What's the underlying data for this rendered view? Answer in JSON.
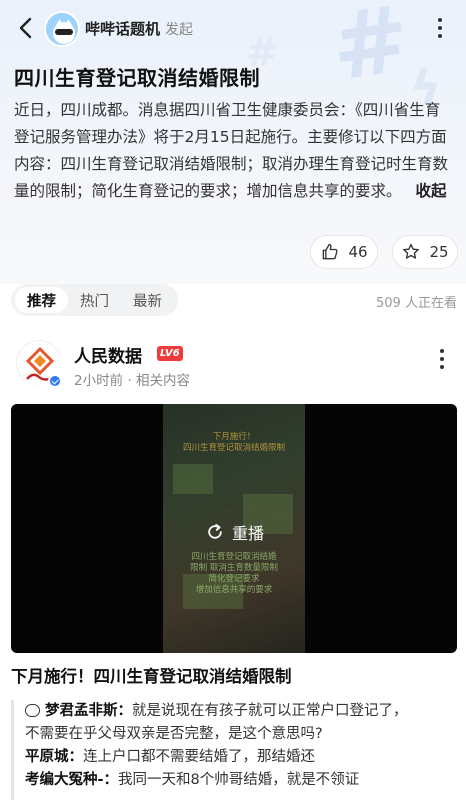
{
  "header": {
    "topic_name": "哔哔话题机",
    "topic_sub": "发起"
  },
  "topic": {
    "title": "四川生育登记取消结婚限制",
    "description": "近日，四川成都。消息据四川省卫生健康委员会：《四川省生育登记服务管理办法》将于2月15日起施行。主要修订以下四方面内容：四川生育登记取消结婚限制；取消办理生育登记时生育数量的限制；简化生育登记的要求；增加信息共享的要求。",
    "collapse_label": "收起",
    "like_count": "46",
    "share_count": "25"
  },
  "tabs": [
    {
      "label": "推荐",
      "active": true
    },
    {
      "label": "热门",
      "active": false
    },
    {
      "label": "最新",
      "active": false
    }
  ],
  "watching": "509 人正在看",
  "post": {
    "author": "人民数据",
    "level": "LV6",
    "meta": "2小时前 · 相关内容",
    "video_caption_lines": [
      "下月施行！",
      "四川生育登记取消结婚限制"
    ],
    "video_body_lines": [
      "四川生育登记取消结婚",
      "限制 取消生育数量限制",
      "简化登记要求",
      "增加信息共享的要求"
    ],
    "replay_label": "重播",
    "video_title": "下月施行！四川生育登记取消结婚限制"
  },
  "comments": [
    {
      "name": "梦君孟非斯：",
      "text": "就是说现在有孩子就可以正常户口登记了，",
      "has_icon": true
    },
    {
      "name": "",
      "text": "不需要在乎父母双亲是否完整，是这个意思吗?",
      "has_icon": false
    },
    {
      "name": "平原城：",
      "text": "连上户口都不需要结婚了，那结婚还",
      "has_icon": false
    },
    {
      "name": "考编大冤种-：",
      "text": "我同一天和8个帅哥结婚，就是不领证",
      "has_icon": false
    }
  ],
  "colors": {
    "accent_blue": "#2f7bf5",
    "level_badge": "#ef3b3b",
    "top_gradient": "#eaf1fb"
  }
}
